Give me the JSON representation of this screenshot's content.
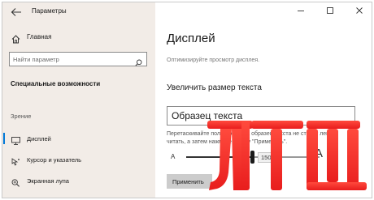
{
  "window": {
    "title": "Параметры",
    "controls": [
      "minimize-icon",
      "maximize-icon",
      "close-icon"
    ]
  },
  "sidebar": {
    "home_label": "Главная",
    "search_placeholder": "Найти параметр",
    "section_title": "Специальные возможности",
    "group_title": "Зрение",
    "items": [
      {
        "label": "Дисплей",
        "icon": "monitor-icon",
        "active": true
      },
      {
        "label": "Курсор и указатель",
        "icon": "cursor-icon",
        "active": false
      },
      {
        "label": "Экранная лупа",
        "icon": "magnifier-icon",
        "active": false
      }
    ]
  },
  "main": {
    "title": "Дисплей",
    "description": "Оптимизируйте просмотр дисплея.",
    "subtitle": "Увеличить размер текста",
    "sample_text": "Образец текста",
    "hint": "Перетаскивайте ползунок, пока образец текста не станет легко читать, а затем нажмите кнопку \"Применить\".",
    "slider": {
      "min_label": "A",
      "max_label": "A",
      "value_label": "150%",
      "fraction": 0.5
    },
    "apply_label": "Применить"
  },
  "colors": {
    "sidebar_bg": "#f2ece7",
    "accent": "#0078d7",
    "logo_red": "#f6302a"
  }
}
